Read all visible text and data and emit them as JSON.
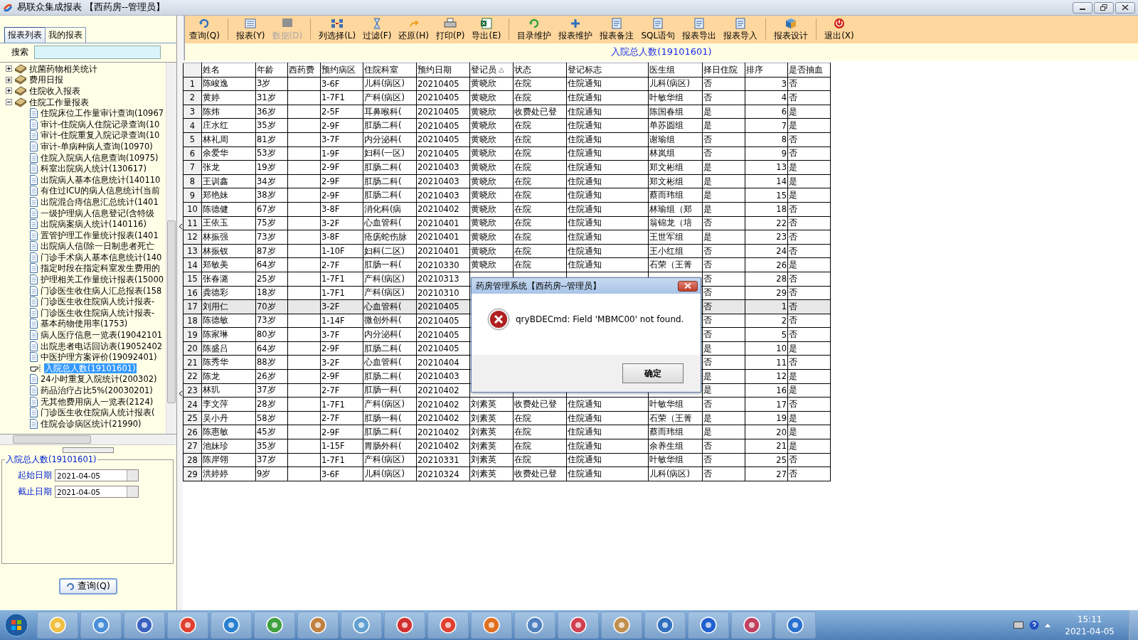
{
  "window": {
    "title": "易联众集成报表 【西药房--管理员】"
  },
  "left_panel": {
    "tabs": [
      {
        "label": "报表列表",
        "selected": true
      },
      {
        "label": "我的报表",
        "selected": false
      }
    ],
    "search_label": "搜索",
    "tree": [
      {
        "label": "抗菌药物相关统计",
        "expanded": false
      },
      {
        "label": "费用日报",
        "expanded": false
      },
      {
        "label": "住院收入报表",
        "expanded": false
      },
      {
        "label": "住院工作量报表",
        "expanded": true,
        "children": [
          {
            "label": "住院床位工作量审计查询(10967",
            "selected": false
          },
          {
            "label": "审计-住院病人住院记录查询(10",
            "selected": false
          },
          {
            "label": "审计-住院重复入院记录查询(10",
            "selected": false
          },
          {
            "label": "审计-单病种病人查询(10970)",
            "selected": false
          },
          {
            "label": "住院入院病人信息查询(10975)",
            "selected": false
          },
          {
            "label": "科室出院病人统计(130617)",
            "selected": false
          },
          {
            "label": "出院病人基本信息统计(140110",
            "selected": false
          },
          {
            "label": "有住过ICU的病人信息统计(当前",
            "selected": false
          },
          {
            "label": "出院混合痔信息汇总统计(1401",
            "selected": false
          },
          {
            "label": "一级护理病人信息登记(含特级",
            "selected": false
          },
          {
            "label": "出院病案病人统计(140116)",
            "selected": false
          },
          {
            "label": "置管护理工作量统计报表(1401",
            "selected": false
          },
          {
            "label": "出院病人信(除一日制患者死亡",
            "selected": false
          },
          {
            "label": "门诊手术病人基本信息统计(140",
            "selected": false
          },
          {
            "label": "指定时段在指定科室发生费用的",
            "selected": false
          },
          {
            "label": "护理相关工作量统计报表(15000",
            "selected": false
          },
          {
            "label": "门诊医生收住病人汇总报表(158",
            "selected": false
          },
          {
            "label": "门诊医生收住院病人统计报表-",
            "selected": false
          },
          {
            "label": "门诊医生收住院病人统计报表-",
            "selected": false
          },
          {
            "label": "基本药物使用率(1753)",
            "selected": false
          },
          {
            "label": "病人医疗信息一览表(19042101",
            "selected": false
          },
          {
            "label": "出院患者电话回访表(19052402",
            "selected": false
          },
          {
            "label": "中医护理方案评价(19092401)",
            "selected": false
          },
          {
            "label": "入院总人数(19101601)",
            "selected": true
          },
          {
            "label": "24小时重复入院统计(200302)",
            "selected": false
          },
          {
            "label": "药品治疗占比5%(20030201)",
            "selected": false
          },
          {
            "label": "无其他费用病人一览表(2124)",
            "selected": false
          },
          {
            "label": "门诊医生收住院病人统计报表(",
            "selected": false
          },
          {
            "label": "住院会诊病区统计(21990)",
            "selected": false
          }
        ]
      }
    ],
    "query_panel": {
      "title": "入院总人数(19101601)",
      "fields": [
        {
          "label": "起始日期",
          "value": "2021-04-05"
        },
        {
          "label": "截止日期",
          "value": "2021-04-05"
        }
      ],
      "button": "查询(Q)"
    }
  },
  "toolbar": {
    "groups": [
      [
        {
          "label": "查询(Q)",
          "disabled": false
        }
      ],
      [
        {
          "label": "报表(Y)",
          "disabled": false
        },
        {
          "label": "数据(D)",
          "disabled": true
        }
      ],
      [
        {
          "label": "列选择(L)",
          "disabled": false
        },
        {
          "label": "过滤(F)",
          "disabled": false
        },
        {
          "label": "还原(H)",
          "disabled": false
        },
        {
          "label": "打印(P)",
          "disabled": false
        },
        {
          "label": "导出(E)",
          "disabled": false
        }
      ],
      [
        {
          "label": "目录维护",
          "disabled": false
        },
        {
          "label": "报表维护",
          "disabled": false
        },
        {
          "label": "报表备注",
          "disabled": false
        },
        {
          "label": "SQL语句",
          "disabled": false
        },
        {
          "label": "报表导出",
          "disabled": false
        },
        {
          "label": "报表导入",
          "disabled": false
        }
      ],
      [
        {
          "label": "报表设计",
          "disabled": false
        }
      ],
      [
        {
          "label": "退出(X)",
          "disabled": false
        }
      ]
    ]
  },
  "report_title": "入院总人数(19101601)",
  "table": {
    "columns": [
      {
        "label": "姓名",
        "sorted": false
      },
      {
        "label": "年龄",
        "sorted": false
      },
      {
        "label": "西药费",
        "sorted": false
      },
      {
        "label": "预约病区",
        "sorted": false
      },
      {
        "label": "住院科室",
        "sorted": false
      },
      {
        "label": "预约日期",
        "sorted": false
      },
      {
        "label": "登记员",
        "sorted": true
      },
      {
        "label": "状态",
        "sorted": false
      },
      {
        "label": "登记标志",
        "sorted": false
      },
      {
        "label": "医生组",
        "sorted": false
      },
      {
        "label": "择日住院",
        "sorted": false
      },
      {
        "label": "排序",
        "sorted": false
      },
      {
        "label": "是否抽血",
        "sorted": false
      }
    ],
    "rows": [
      {
        "no": "1",
        "selected": false,
        "cells": [
          "陈峻逸",
          "3岁",
          null,
          "3-6F",
          "儿科(病区)",
          "20210405",
          "黄晓欣",
          "在院",
          "住院通知",
          "儿科(病区)",
          "否",
          "3",
          "否"
        ]
      },
      {
        "no": "2",
        "selected": false,
        "cells": [
          "黄婷",
          "31岁",
          null,
          "1-7F1",
          "产科(病区)",
          "20210405",
          "黄晓欣",
          "在院",
          "住院通知",
          "叶敏华组",
          "否",
          "4",
          "否"
        ]
      },
      {
        "no": "3",
        "selected": false,
        "cells": [
          "陈炜",
          "36岁",
          null,
          "2-5F",
          "耳鼻喉科(",
          "20210405",
          "黄晓欣",
          "收费处已登",
          "住院通知",
          "陈国春组",
          "是",
          "6",
          "是"
        ]
      },
      {
        "no": "4",
        "selected": false,
        "cells": [
          "庄水红",
          "35岁",
          null,
          "2-9F",
          "肛肠二科(",
          "20210405",
          "黄晓欣",
          "在院",
          "住院通知",
          "单苏圆组",
          "是",
          "7",
          "是"
        ]
      },
      {
        "no": "5",
        "selected": false,
        "cells": [
          "林礼周",
          "81岁",
          null,
          "3-7F",
          "内分泌科(",
          "20210405",
          "黄晓欣",
          "在院",
          "住院通知",
          "谢瑜组",
          "否",
          "8",
          "否"
        ]
      },
      {
        "no": "6",
        "selected": false,
        "cells": [
          "余爱华",
          "53岁",
          null,
          "1-9F",
          "妇科(一区)",
          "20210405",
          "黄晓欣",
          "在院",
          "住院通知",
          "林岚组",
          "否",
          "9",
          "否"
        ]
      },
      {
        "no": "7",
        "selected": false,
        "cells": [
          "张龙",
          "19岁",
          null,
          "2-9F",
          "肛肠二科(",
          "20210403",
          "黄晓欣",
          "在院",
          "住院通知",
          "郑文彬组",
          "是",
          "13",
          "是"
        ]
      },
      {
        "no": "8",
        "selected": false,
        "cells": [
          "王训鑫",
          "34岁",
          null,
          "2-9F",
          "肛肠二科(",
          "20210403",
          "黄晓欣",
          "在院",
          "住院通知",
          "郑文彬组",
          "是",
          "14",
          "是"
        ]
      },
      {
        "no": "9",
        "selected": false,
        "cells": [
          "郑艳妹",
          "38岁",
          null,
          "2-9F",
          "肛肠二科(",
          "20210403",
          "黄晓欣",
          "在院",
          "住院通知",
          "蔡而玮组",
          "是",
          "15",
          "是"
        ]
      },
      {
        "no": "10",
        "selected": false,
        "cells": [
          "陈德健",
          "67岁",
          null,
          "3-8F",
          "消化科(病",
          "20210402",
          "黄晓欣",
          "在院",
          "住院通知",
          "林瑜组（郑",
          "是",
          "18",
          "否"
        ]
      },
      {
        "no": "11",
        "selected": false,
        "cells": [
          "王依玉",
          "75岁",
          null,
          "3-2F",
          "心血管科(",
          "20210401",
          "黄晓欣",
          "在院",
          "住院通知",
          "翁锦龙（培",
          "否",
          "22",
          "否"
        ]
      },
      {
        "no": "12",
        "selected": false,
        "cells": [
          "林振强",
          "73岁",
          null,
          "3-8F",
          "疮疡蛇伤脉",
          "20210401",
          "黄晓欣",
          "在院",
          "住院通知",
          "王世军组",
          "是",
          "23",
          "否"
        ]
      },
      {
        "no": "13",
        "selected": false,
        "cells": [
          "林振钗",
          "87岁",
          null,
          "1-10F",
          "妇科(二区)",
          "20210401",
          "黄晓欣",
          "在院",
          "住院通知",
          "王小红组",
          "否",
          "24",
          "否"
        ]
      },
      {
        "no": "14",
        "selected": false,
        "cells": [
          "郑敏美",
          "64岁",
          null,
          "2-7F",
          "肛肠一科(",
          "20210330",
          "黄晓欣",
          "在院",
          "住院通知",
          "石荣（王菁",
          "否",
          "26",
          "是"
        ]
      },
      {
        "no": "15",
        "selected": false,
        "cells": [
          "张春潞",
          "25岁",
          null,
          "1-7F1",
          "产科(病区)",
          "20210313",
          null,
          null,
          null,
          null,
          "否",
          "28",
          "否"
        ]
      },
      {
        "no": "16",
        "selected": false,
        "cells": [
          "龚德彩",
          "18岁",
          null,
          "1-7F1",
          "产科(病区)",
          "20210310",
          null,
          null,
          null,
          null,
          "否",
          "29",
          "否"
        ]
      },
      {
        "no": "17",
        "selected": true,
        "cells": [
          "刘用仁",
          "70岁",
          null,
          "3-2F",
          "心血管科(",
          "20210405",
          null,
          null,
          null,
          null,
          "否",
          "1",
          "否"
        ]
      },
      {
        "no": "18",
        "selected": false,
        "cells": [
          "陈德敏",
          "73岁",
          null,
          "1-14F",
          "微创外科(",
          "20210405",
          null,
          null,
          null,
          null,
          "否",
          "2",
          "否"
        ]
      },
      {
        "no": "19",
        "selected": false,
        "cells": [
          "陈家琳",
          "80岁",
          null,
          "3-7F",
          "内分泌科(",
          "20210405",
          null,
          null,
          null,
          null,
          "否",
          "5",
          "否"
        ]
      },
      {
        "no": "20",
        "selected": false,
        "cells": [
          "陈盛吕",
          "64岁",
          null,
          "2-9F",
          "肛肠二科(",
          "20210405",
          null,
          null,
          null,
          null,
          "是",
          "10",
          "是"
        ]
      },
      {
        "no": "21",
        "selected": false,
        "cells": [
          "陈秀华",
          "88岁",
          null,
          "3-2F",
          "心血管科(",
          "20210404",
          null,
          null,
          null,
          null,
          "否",
          "11",
          "否"
        ]
      },
      {
        "no": "22",
        "selected": false,
        "cells": [
          "陈龙",
          "26岁",
          null,
          "2-9F",
          "肛肠二科(",
          "20210403",
          null,
          null,
          null,
          null,
          "是",
          "12",
          "是"
        ]
      },
      {
        "no": "23",
        "selected": false,
        "cells": [
          "林玑",
          "37岁",
          null,
          "2-7F",
          "肛肠一科(",
          "20210402",
          null,
          null,
          null,
          null,
          "是",
          "16",
          "是"
        ]
      },
      {
        "no": "24",
        "selected": false,
        "cells": [
          "李文萍",
          "28岁",
          null,
          "1-7F1",
          "产科(病区)",
          "20210402",
          "刘素英",
          "收费处已登",
          "住院通知",
          "叶敏华组",
          "否",
          "17",
          "否"
        ]
      },
      {
        "no": "25",
        "selected": false,
        "cells": [
          "吴小丹",
          "58岁",
          null,
          "2-7F",
          "肛肠一科(",
          "20210402",
          "刘素英",
          "在院",
          "住院通知",
          "石荣（王菁",
          "是",
          "19",
          "是"
        ]
      },
      {
        "no": "26",
        "selected": false,
        "cells": [
          "陈惠敏",
          "45岁",
          null,
          "2-9F",
          "肛肠二科(",
          "20210402",
          "刘素英",
          "在院",
          "住院通知",
          "蔡而玮组",
          "是",
          "20",
          "是"
        ]
      },
      {
        "no": "27",
        "selected": false,
        "cells": [
          "池妹珍",
          "35岁",
          null,
          "1-15F",
          "胃肠外科(",
          "20210402",
          "刘素英",
          "在院",
          "住院通知",
          "余养生组",
          "否",
          "21",
          "是"
        ]
      },
      {
        "no": "28",
        "selected": false,
        "cells": [
          "陈岸翎",
          "37岁",
          null,
          "1-7F1",
          "产科(病区)",
          "20210331",
          "刘素英",
          "在院",
          "住院通知",
          "叶敏华组",
          "否",
          "25",
          "否"
        ]
      },
      {
        "no": "29",
        "selected": false,
        "cells": [
          "洪婷婷",
          "9岁",
          null,
          "3-6F",
          "儿科(病区)",
          "20210324",
          "刘素英",
          "收费处已登",
          "住院通知",
          "儿科(病区)",
          "否",
          "27",
          "否"
        ]
      }
    ]
  },
  "dialog": {
    "title": "药房管理系统【西药房--管理员】",
    "message": "qryBDECmd: Field 'MBMC00' not found.",
    "button": "确定"
  },
  "taskbar": {
    "time": "15:11",
    "date": "2021-04-05"
  }
}
